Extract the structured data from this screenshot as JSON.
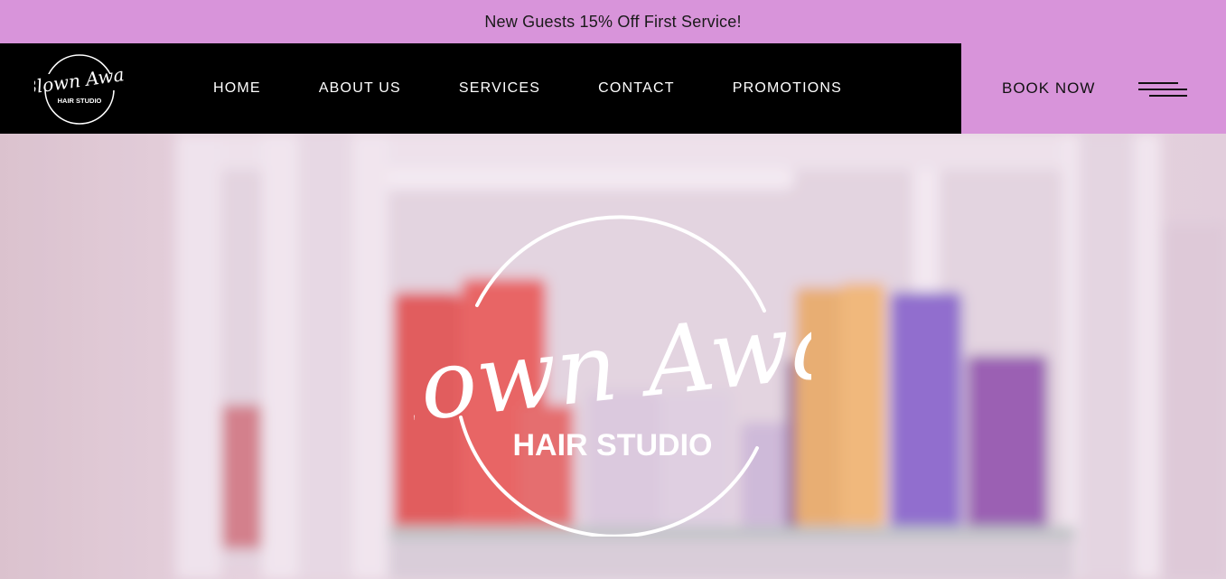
{
  "promo": {
    "text": "New Guests 15% Off First Service!"
  },
  "header": {
    "logo": {
      "script_text": "Blown Away",
      "sub_text": "HAIR STUDIO"
    },
    "nav": [
      {
        "label": "HOME"
      },
      {
        "label": "ABOUT US"
      },
      {
        "label": "SERVICES"
      },
      {
        "label": "CONTACT"
      },
      {
        "label": "PROMOTIONS"
      }
    ],
    "book_now_label": "BOOK NOW",
    "menu_icon": "hamburger-menu-icon"
  },
  "hero": {
    "logo": {
      "script_text": "Blown Away",
      "sub_text": "HAIR STUDIO"
    }
  },
  "colors": {
    "accent_pink": "#d894da",
    "nav_black": "#000000",
    "nav_text": "#ffffff"
  }
}
